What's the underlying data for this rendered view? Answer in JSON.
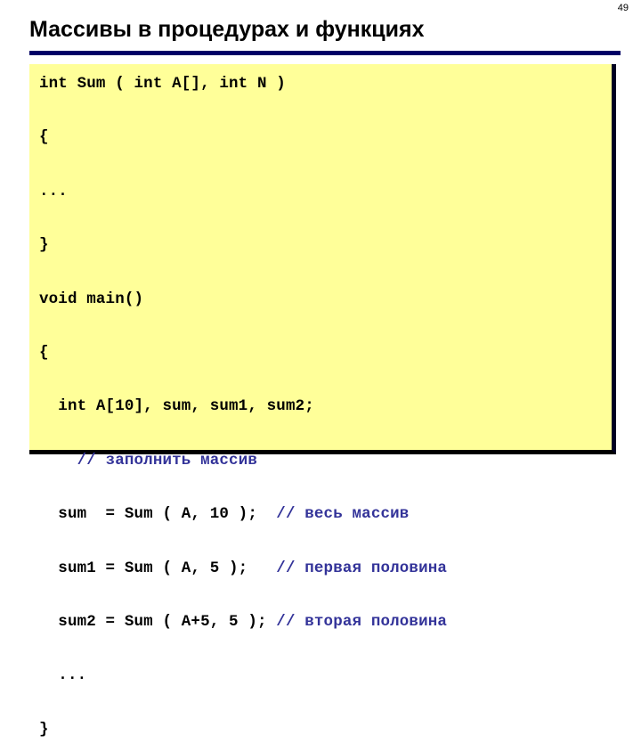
{
  "slide": {
    "page_number": "49",
    "title": "Массивы в процедурах и функциях",
    "accent_rule_color": "#000066",
    "code_background_color": "#ffff99",
    "code_text_color": "#000000",
    "comment_text_color": "#333399"
  },
  "code": {
    "lines": [
      {
        "code": "int Sum ( int A[], int N )",
        "comment": ""
      },
      {
        "code": "{",
        "comment": ""
      },
      {
        "code": "...",
        "comment": ""
      },
      {
        "code": "}",
        "comment": ""
      },
      {
        "code": "void main()",
        "comment": ""
      },
      {
        "code": "{",
        "comment": ""
      },
      {
        "code": "  int A[10], sum, sum1, sum2;",
        "comment": ""
      },
      {
        "code": "    ",
        "comment": "// заполнить массив"
      },
      {
        "code": "  sum  = Sum ( A, 10 );  ",
        "comment": "// весь массив"
      },
      {
        "code": "  sum1 = Sum ( A, 5 );   ",
        "comment": "// первая половина"
      },
      {
        "code": "  sum2 = Sum ( A+5, 5 ); ",
        "comment": "// вторая половина"
      },
      {
        "code": "  ...",
        "comment": ""
      },
      {
        "code": "}",
        "comment": ""
      }
    ]
  }
}
